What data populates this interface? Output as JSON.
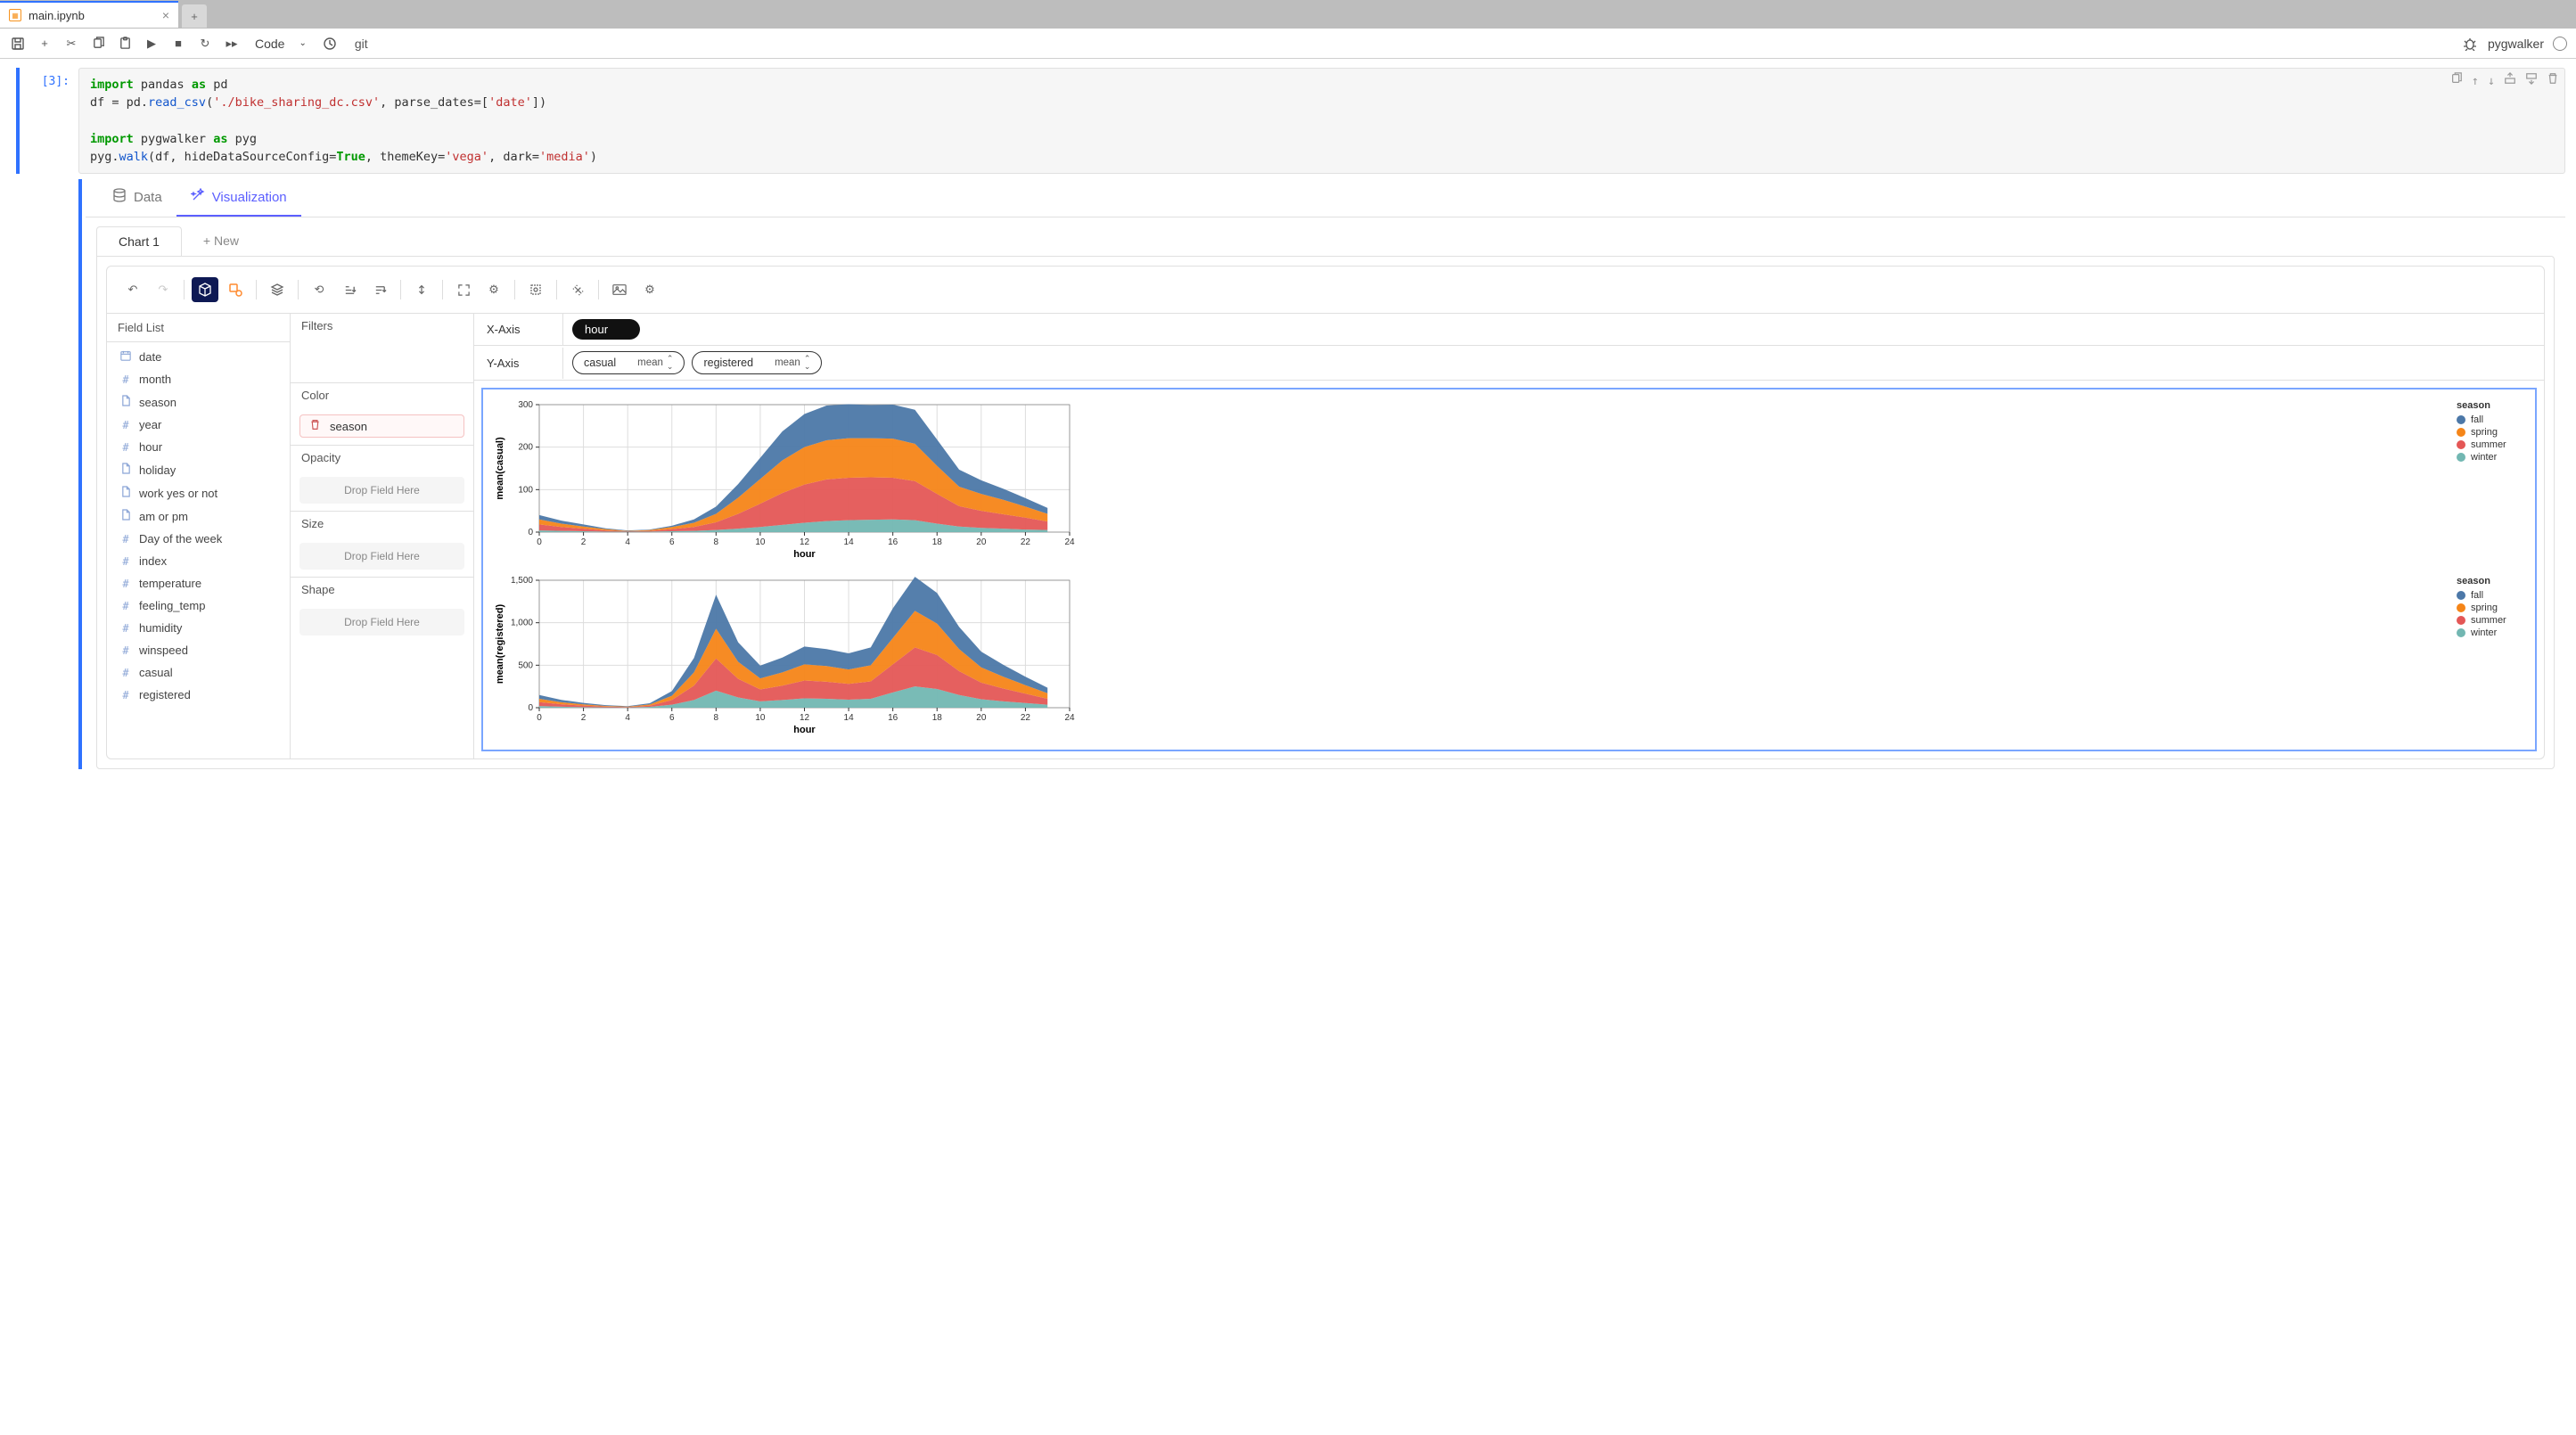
{
  "tab": {
    "title": "main.ipynb"
  },
  "toolbar": {
    "cell_type": "Code",
    "git_label": "git",
    "kernel_name": "pygwalker"
  },
  "cell": {
    "prompt": "[3]:",
    "code_lines": [
      {
        "t": "import ",
        "c": "kw"
      },
      {
        "t": "pandas ",
        "c": ""
      },
      {
        "t": "as ",
        "c": "kw"
      },
      {
        "t": "pd",
        "c": ""
      },
      {
        "nl": true
      },
      {
        "t": "df = pd.",
        "c": ""
      },
      {
        "t": "read_csv",
        "c": "fn"
      },
      {
        "t": "(",
        "c": ""
      },
      {
        "t": "'./bike_sharing_dc.csv'",
        "c": "str"
      },
      {
        "t": ", parse_dates=[",
        "c": ""
      },
      {
        "t": "'date'",
        "c": "str"
      },
      {
        "t": "])",
        "c": ""
      },
      {
        "nl": true
      },
      {
        "nl": true
      },
      {
        "t": "import ",
        "c": "kw"
      },
      {
        "t": "pygwalker ",
        "c": ""
      },
      {
        "t": "as ",
        "c": "kw"
      },
      {
        "t": "pyg",
        "c": ""
      },
      {
        "nl": true
      },
      {
        "t": "pyg.",
        "c": ""
      },
      {
        "t": "walk",
        "c": "fn"
      },
      {
        "t": "(df, hideDataSourceConfig=",
        "c": ""
      },
      {
        "t": "True",
        "c": "builtin"
      },
      {
        "t": ", themeKey=",
        "c": ""
      },
      {
        "t": "'vega'",
        "c": "str"
      },
      {
        "t": ", dark=",
        "c": ""
      },
      {
        "t": "'media'",
        "c": "str"
      },
      {
        "t": ")",
        "c": ""
      }
    ]
  },
  "pw": {
    "tabs": {
      "data": "Data",
      "viz": "Visualization"
    },
    "chart_tabs": {
      "chart1": "Chart 1",
      "new": "+ New"
    },
    "fieldlist_title": "Field List",
    "fields": [
      {
        "icon": "cal",
        "label": "date"
      },
      {
        "icon": "hash",
        "label": "month"
      },
      {
        "icon": "doc",
        "label": "season"
      },
      {
        "icon": "hash",
        "label": "year"
      },
      {
        "icon": "hash",
        "label": "hour"
      },
      {
        "icon": "doc",
        "label": "holiday"
      },
      {
        "icon": "doc",
        "label": "work yes or not"
      },
      {
        "icon": "doc",
        "label": "am or pm"
      },
      {
        "icon": "hash",
        "label": "Day of the week"
      },
      {
        "icon": "hash",
        "label": "index"
      },
      {
        "icon": "hash",
        "label": "temperature"
      },
      {
        "icon": "hash",
        "label": "feeling_temp"
      },
      {
        "icon": "hash",
        "label": "humidity"
      },
      {
        "icon": "hash",
        "label": "winspeed"
      },
      {
        "icon": "hash",
        "label": "casual"
      },
      {
        "icon": "hash",
        "label": "registered"
      }
    ],
    "shelves": {
      "filters": "Filters",
      "color": "Color",
      "opacity": "Opacity",
      "size": "Size",
      "shape": "Shape",
      "drop_here": "Drop Field Here",
      "color_field": "season"
    },
    "enc": {
      "x_label": "X-Axis",
      "y_label": "Y-Axis",
      "x_pill": "hour",
      "y_pill_1": "casual",
      "y_pill_1_agg": "mean",
      "y_pill_2": "registered",
      "y_pill_2_agg": "mean"
    },
    "legend_title": "season",
    "legend_items": [
      {
        "label": "fall",
        "color": "#4c78a8"
      },
      {
        "label": "spring",
        "color": "#f58518"
      },
      {
        "label": "summer",
        "color": "#e45756"
      },
      {
        "label": "winter",
        "color": "#72b7b2"
      }
    ]
  },
  "chart_data": [
    {
      "type": "area",
      "stacked": true,
      "title": "",
      "xlabel": "hour",
      "ylabel": "mean(casual)",
      "xlim": [
        0,
        24
      ],
      "ylim": [
        0,
        300
      ],
      "xticks": [
        0,
        2,
        4,
        6,
        8,
        10,
        12,
        14,
        16,
        18,
        20,
        22,
        24
      ],
      "yticks": [
        0,
        100,
        200,
        300
      ],
      "x": [
        0,
        1,
        2,
        3,
        4,
        5,
        6,
        7,
        8,
        9,
        10,
        11,
        12,
        13,
        14,
        15,
        16,
        17,
        18,
        19,
        20,
        21,
        22,
        23
      ],
      "series": [
        {
          "name": "winter",
          "color": "#72b7b2",
          "values": [
            4,
            3,
            2,
            1,
            1,
            1,
            2,
            3,
            5,
            8,
            12,
            17,
            22,
            26,
            28,
            29,
            30,
            28,
            20,
            13,
            10,
            8,
            6,
            5
          ]
        },
        {
          "name": "summer",
          "color": "#e45756",
          "values": [
            14,
            9,
            6,
            3,
            1,
            2,
            5,
            9,
            18,
            35,
            55,
            75,
            90,
            98,
            100,
            100,
            98,
            92,
            70,
            48,
            40,
            34,
            28,
            20
          ]
        },
        {
          "name": "spring",
          "color": "#f58518",
          "values": [
            12,
            8,
            5,
            3,
            1,
            2,
            5,
            10,
            20,
            38,
            58,
            77,
            88,
            92,
            93,
            92,
            92,
            88,
            66,
            46,
            40,
            34,
            26,
            18
          ]
        },
        {
          "name": "fall",
          "color": "#4c78a8",
          "values": [
            10,
            7,
            5,
            2,
            1,
            1,
            3,
            8,
            17,
            32,
            50,
            68,
            78,
            82,
            80,
            78,
            80,
            80,
            62,
            40,
            32,
            26,
            20,
            14
          ]
        }
      ]
    },
    {
      "type": "area",
      "stacked": true,
      "title": "",
      "xlabel": "hour",
      "ylabel": "mean(registered)",
      "xlim": [
        0,
        24
      ],
      "ylim": [
        0,
        1500
      ],
      "xticks": [
        0,
        2,
        4,
        6,
        8,
        10,
        12,
        14,
        16,
        18,
        20,
        22,
        24
      ],
      "yticks": [
        0,
        500,
        1000,
        1500
      ],
      "x": [
        0,
        1,
        2,
        3,
        4,
        5,
        6,
        7,
        8,
        9,
        10,
        11,
        12,
        13,
        14,
        15,
        16,
        17,
        18,
        19,
        20,
        21,
        22,
        23
      ],
      "series": [
        {
          "name": "winter",
          "color": "#72b7b2",
          "values": [
            20,
            12,
            7,
            4,
            3,
            10,
            35,
            90,
            200,
            120,
            75,
            90,
            110,
            105,
            95,
            105,
            180,
            250,
            220,
            150,
            100,
            75,
            55,
            35
          ]
        },
        {
          "name": "summer",
          "color": "#e45756",
          "values": [
            45,
            28,
            18,
            9,
            5,
            14,
            55,
            170,
            380,
            220,
            140,
            170,
            210,
            200,
            185,
            205,
            330,
            460,
            400,
            280,
            195,
            150,
            110,
            70
          ]
        },
        {
          "name": "spring",
          "color": "#f58518",
          "values": [
            40,
            24,
            14,
            8,
            5,
            14,
            50,
            155,
            350,
            200,
            130,
            155,
            190,
            185,
            170,
            190,
            310,
            430,
            370,
            260,
            180,
            140,
            100,
            65
          ]
        },
        {
          "name": "fall",
          "color": "#4c78a8",
          "values": [
            45,
            28,
            18,
            9,
            5,
            14,
            55,
            170,
            400,
            230,
            150,
            175,
            210,
            200,
            190,
            210,
            350,
            400,
            360,
            260,
            185,
            140,
            100,
            65
          ]
        }
      ]
    }
  ]
}
